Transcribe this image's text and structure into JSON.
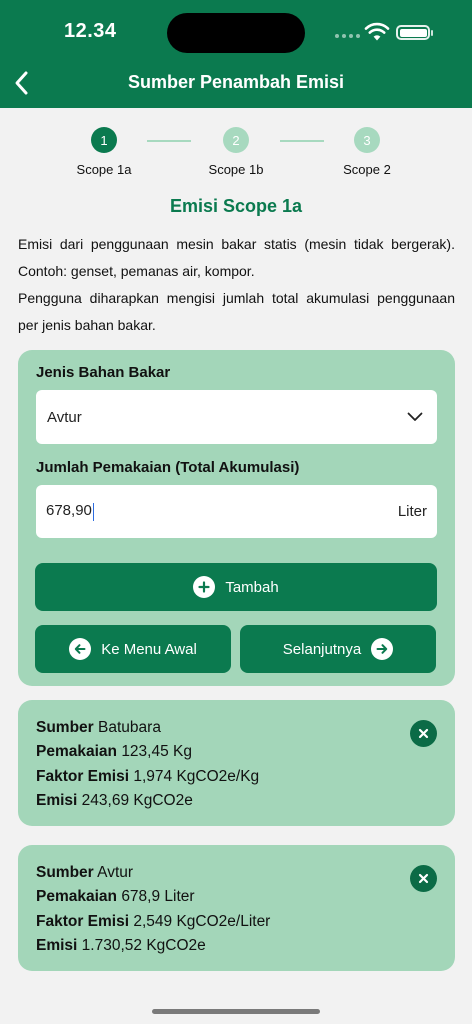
{
  "status_bar": {
    "time": "12.34"
  },
  "header": {
    "title": "Sumber Penambah Emisi"
  },
  "steps": [
    {
      "number": "1",
      "label": "Scope 1a"
    },
    {
      "number": "2",
      "label": "Scope 1b"
    },
    {
      "number": "3",
      "label": "Scope 2"
    }
  ],
  "section_title": "Emisi Scope 1a",
  "description": {
    "line1": "Emisi dari penggunaan mesin bakar statis (mesin tidak bergerak). Contoh: genset, pemanas air, kompor.",
    "line2": "Pengguna diharapkan mengisi jumlah total akumulasi penggunaan per jenis bahan bakar."
  },
  "form": {
    "fuel_label": "Jenis Bahan Bakar",
    "fuel_value": "Avtur",
    "usage_label": "Jumlah Pemakaian (Total Akumulasi)",
    "usage_value": "678,90",
    "usage_unit": "Liter",
    "add_label": "Tambah",
    "home_label": "Ke Menu Awal",
    "next_label": "Selanjutnya"
  },
  "items": [
    {
      "source_key": "Sumber",
      "source_val": "Batubara",
      "usage_key": "Pemakaian",
      "usage_val": "123,45 Kg",
      "factor_key": "Faktor Emisi",
      "factor_val": "1,974 KgCO2e/Kg",
      "emission_key": "Emisi",
      "emission_val": "243,69 KgCO2e"
    },
    {
      "source_key": "Sumber",
      "source_val": "Avtur",
      "usage_key": "Pemakaian",
      "usage_val": "678,9 Liter",
      "factor_key": "Faktor Emisi",
      "factor_val": "2,549 KgCO2e/Liter",
      "emission_key": "Emisi",
      "emission_val": "1.730,52 KgCO2e"
    }
  ],
  "colors": {
    "primary": "#0b7a4f",
    "card": "#a3d6b9",
    "step_inactive": "#a7d9bf",
    "background": "#f2f2f2"
  }
}
